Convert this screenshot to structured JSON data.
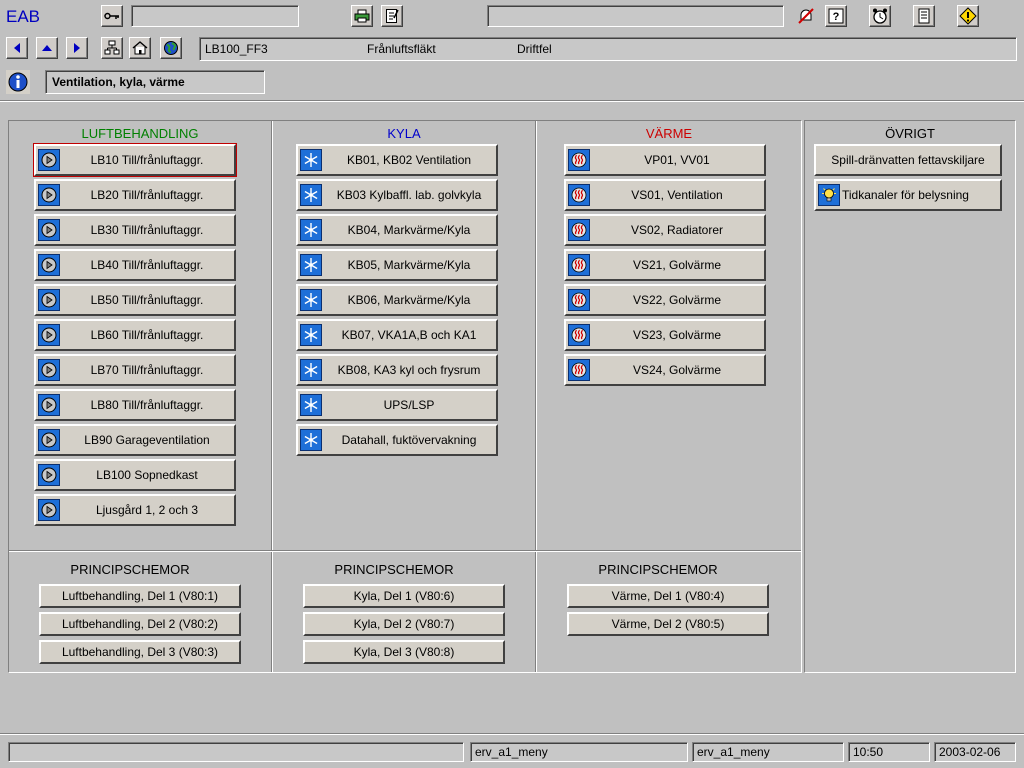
{
  "app": {
    "title": "EAB"
  },
  "toolbar1": {
    "key_icon": "key-icon",
    "print_icon": "printer-icon",
    "notes_icon": "notepad-icon",
    "search_value": "",
    "message_value": ""
  },
  "toolbar2": {
    "object_id": "LB100_FF3",
    "object_desc": "Frånluftsfläkt",
    "object_state": "Driftfel"
  },
  "infobar": {
    "label": "Ventilation, kyla, värme"
  },
  "colors": {
    "luft": "#008000",
    "kyla": "#0000cc",
    "varme": "#cc0000",
    "accent": "#1e6fd8"
  },
  "sections": {
    "luft": {
      "title": "LUFTBEHANDLING",
      "items": [
        "LB10 Till/frånluftaggr.",
        "LB20 Till/frånluftaggr.",
        "LB30 Till/frånluftaggr.",
        "LB40 Till/frånluftaggr.",
        "LB50 Till/frånluftaggr.",
        "LB60 Till/frånluftaggr.",
        "LB70 Till/frånluftaggr.",
        "LB80 Till/frånluftaggr.",
        "LB90 Garageventilation",
        "LB100 Sopnedkast",
        "Ljusgård 1, 2 och 3"
      ]
    },
    "kyla": {
      "title": "KYLA",
      "items": [
        "KB01, KB02 Ventilation",
        "KB03 Kylbaffl. lab. golvkyla",
        "KB04, Markvärme/Kyla",
        "KB05, Markvärme/Kyla",
        "KB06, Markvärme/Kyla",
        "KB07, VKA1A,B och KA1",
        "KB08, KA3 kyl och frysrum",
        "UPS/LSP",
        "Datahall, fuktövervakning"
      ]
    },
    "varme": {
      "title": "VÄRME",
      "items": [
        "VP01, VV01",
        "VS01, Ventilation",
        "VS02, Radiatorer",
        "VS21, Golvärme",
        "VS22, Golvärme",
        "VS23, Golvärme",
        "VS24, Golvärme"
      ]
    },
    "ovrigt": {
      "title": "ÖVRIGT",
      "items": [
        "Spill-dränvatten fettavskiljare",
        "Tidkanaler för belysning"
      ]
    }
  },
  "principles": {
    "luft": {
      "title": "PRINCIPSCHEMOR",
      "items": [
        "Luftbehandling, Del 1 (V80:1)",
        "Luftbehandling, Del 2 (V80:2)",
        "Luftbehandling, Del 3 (V80:3)"
      ]
    },
    "kyla": {
      "title": "PRINCIPSCHEMOR",
      "items": [
        "Kyla, Del 1 (V80:6)",
        "Kyla, Del 2 (V80:7)",
        "Kyla, Del 3 (V80:8)"
      ]
    },
    "varme": {
      "title": "PRINCIPSCHEMOR",
      "items": [
        "Värme, Del 1 (V80:4)",
        "Värme, Del 2 (V80:5)"
      ]
    }
  },
  "statusbar": {
    "message": "",
    "picture1": "erv_a1_meny",
    "picture2": "erv_a1_meny",
    "time": "10:50",
    "date": "2003-02-06"
  }
}
